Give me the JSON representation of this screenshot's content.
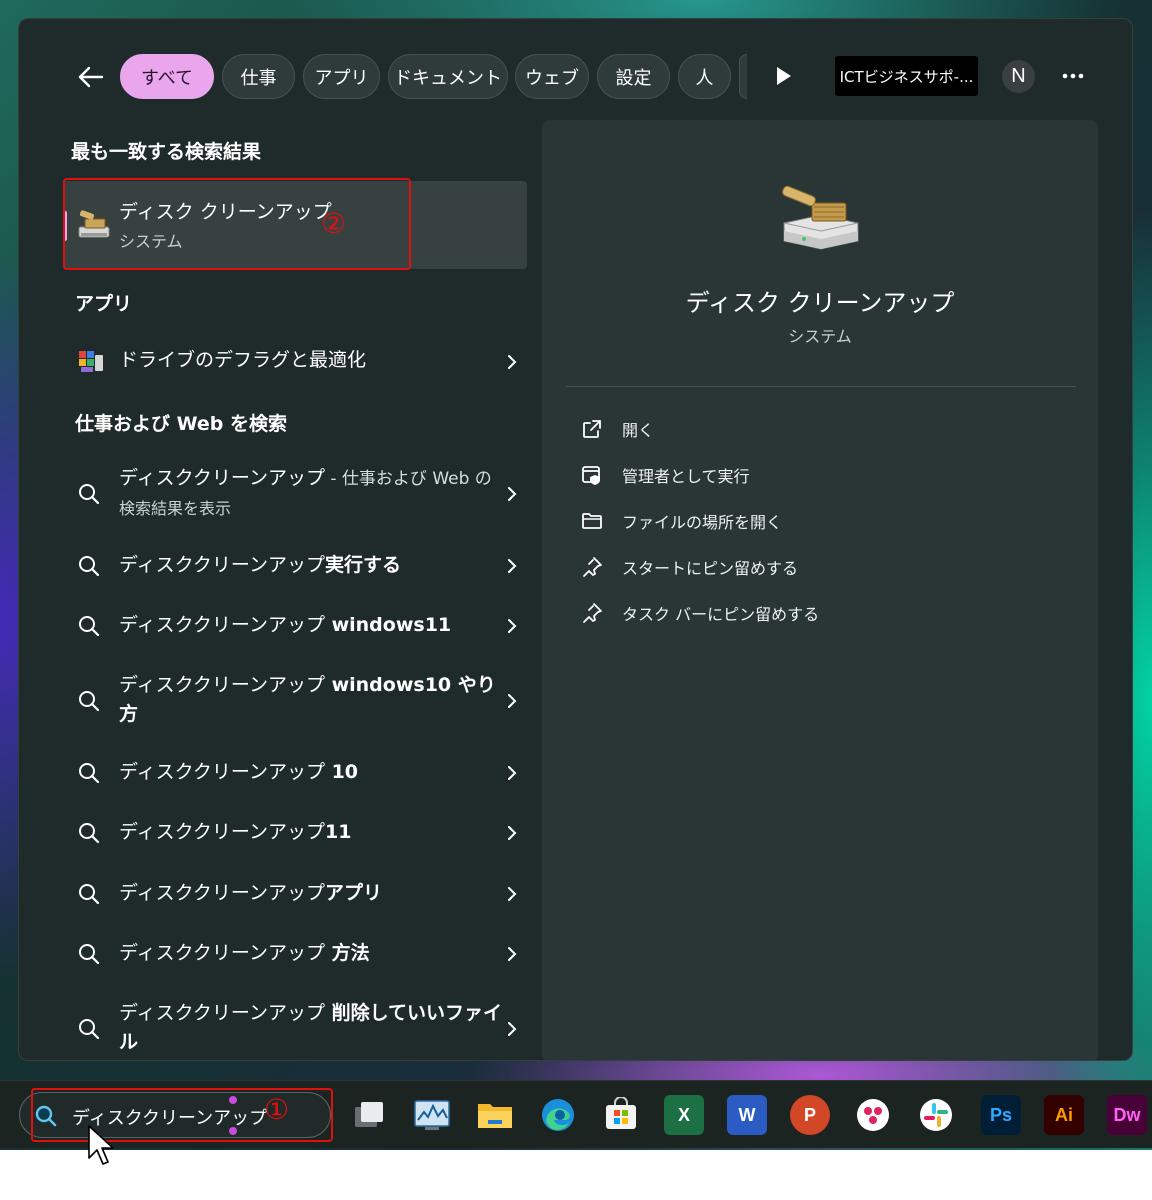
{
  "filters": {
    "tabs": [
      {
        "label": "すべて",
        "active": true
      },
      {
        "label": "仕事"
      },
      {
        "label": "アプリ"
      },
      {
        "label": "ドキュメント"
      },
      {
        "label": "ウェブ"
      },
      {
        "label": "設定"
      },
      {
        "label": "人"
      }
    ],
    "account_label": "ICTビジネスサポ-...",
    "avatar_initial": "N"
  },
  "best_match": {
    "heading": "最も一致する検索結果",
    "title": "ディスク クリーンアップ",
    "subtitle": "システム",
    "annotation": "②"
  },
  "apps": {
    "heading": "アプリ",
    "items": [
      {
        "label": "ドライブのデフラグと最適化",
        "icon": "defrag-icon"
      }
    ]
  },
  "web": {
    "heading": "仕事および Web を検索",
    "items": [
      {
        "text": "ディスククリーンアップ",
        "suffix": " - 仕事および Web の",
        "second": "検索結果を表示"
      },
      {
        "text": "ディスククリーンアップ",
        "bold": "実行する"
      },
      {
        "text": "ディスククリーンアップ",
        "bold": " windows11"
      },
      {
        "text": "ディスククリーンアップ",
        "bold": " windows10 やり",
        "second_bold": "方"
      },
      {
        "text": "ディスククリーンアップ",
        "bold": " 10"
      },
      {
        "text": "ディスククリーンアップ",
        "bold": "11"
      },
      {
        "text": "ディスククリーンアップ",
        "bold": "アプリ"
      },
      {
        "text": "ディスククリーンアップ",
        "bold": " 方法"
      },
      {
        "text": "ディスククリーンアップ",
        "bold": " 削除していいファイ",
        "second_bold": "ル"
      }
    ]
  },
  "preview": {
    "title": "ディスク クリーンアップ",
    "subtitle": "システム",
    "actions": [
      {
        "label": "開く",
        "icon": "open-external-icon"
      },
      {
        "label": "管理者として実行",
        "icon": "run-as-admin-icon"
      },
      {
        "label": "ファイルの場所を開く",
        "icon": "folder-icon"
      },
      {
        "label": "スタートにピン留めする",
        "icon": "pin-icon"
      },
      {
        "label": "タスク バーにピン留めする",
        "icon": "pin-icon"
      }
    ]
  },
  "taskbar": {
    "search_text": "ディスククリーンアップ",
    "annotation": "①",
    "apps": [
      {
        "name": "task-view-icon"
      },
      {
        "name": "performance-monitor-icon"
      },
      {
        "name": "file-explorer-icon"
      },
      {
        "name": "edge-icon"
      },
      {
        "name": "microsoft-store-icon"
      },
      {
        "name": "excel-icon",
        "label": "X"
      },
      {
        "name": "word-icon",
        "label": "W"
      },
      {
        "name": "powerpoint-icon",
        "label": "P"
      },
      {
        "name": "app-dots-icon"
      },
      {
        "name": "slack-icon"
      },
      {
        "name": "photoshop-icon",
        "label": "Ps"
      },
      {
        "name": "illustrator-icon",
        "label": "Ai"
      },
      {
        "name": "dreamweaver-icon",
        "label": "Dw"
      }
    ]
  },
  "colors": {
    "accent": "#e9a6ec",
    "annotation_red": "#e11010",
    "panel": "#1f2b2a",
    "preview": "#2a3635"
  }
}
